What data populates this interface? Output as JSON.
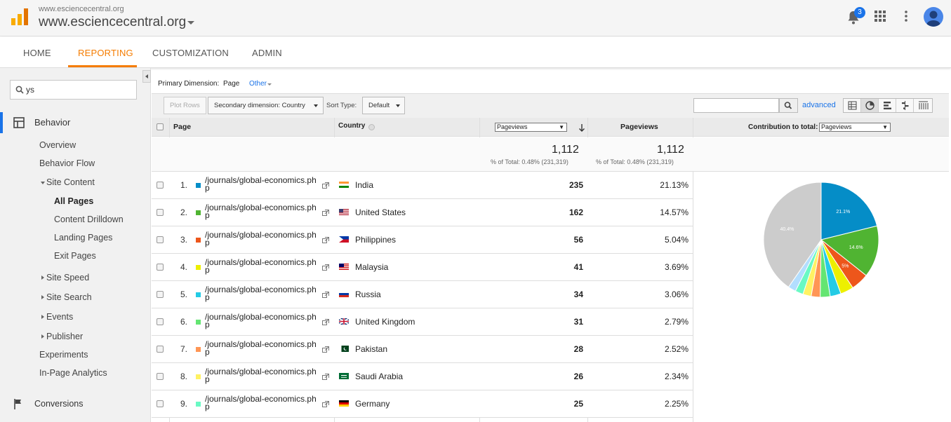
{
  "header": {
    "property_small": "www.esciencecentral.org",
    "property_main": "www.esciencecentral.org",
    "notification_count": "3"
  },
  "tabs": [
    {
      "label": "HOME"
    },
    {
      "label": "REPORTING"
    },
    {
      "label": "CUSTOMIZATION"
    },
    {
      "label": "ADMIN"
    }
  ],
  "sidebar": {
    "search_value": "ys",
    "behavior_label": "Behavior",
    "items": [
      {
        "label": "Overview"
      },
      {
        "label": "Behavior Flow"
      },
      {
        "label": "Site Content"
      },
      {
        "label": "All Pages"
      },
      {
        "label": "Content Drilldown"
      },
      {
        "label": "Landing Pages"
      },
      {
        "label": "Exit Pages"
      },
      {
        "label": "Site Speed"
      },
      {
        "label": "Site Search"
      },
      {
        "label": "Events"
      },
      {
        "label": "Publisher"
      },
      {
        "label": "Experiments"
      },
      {
        "label": "In-Page Analytics"
      }
    ],
    "conversions_label": "Conversions"
  },
  "primary_dimension": {
    "label": "Primary Dimension:",
    "current": "Page",
    "other": "Other"
  },
  "controls": {
    "plot_rows": "Plot Rows",
    "secondary_dimension": "Secondary dimension: Country",
    "sort_type_label": "Sort Type:",
    "sort_type_value": "Default",
    "advanced": "advanced"
  },
  "table": {
    "headers": {
      "page": "Page",
      "country": "Country",
      "metric_select": "Pageviews",
      "pageviews": "Pageviews",
      "contribution": "Contribution to total:",
      "contribution_select": "Pageviews"
    },
    "totals": {
      "metric1": "1,112",
      "metric1_sub": "% of Total: 0.48% (231,319)",
      "metric2": "1,112",
      "metric2_sub": "% of Total: 0.48% (231,319)"
    },
    "rows": [
      {
        "num": "1.",
        "page_line1": "/journals/global-economics.ph",
        "page_line2": "p",
        "country": "India",
        "pageviews": "235",
        "percent": "21.13%"
      },
      {
        "num": "2.",
        "page_line1": "/journals/global-economics.ph",
        "page_line2": "p",
        "country": "United States",
        "pageviews": "162",
        "percent": "14.57%"
      },
      {
        "num": "3.",
        "page_line1": "/journals/global-economics.ph",
        "page_line2": "p",
        "country": "Philippines",
        "pageviews": "56",
        "percent": "5.04%"
      },
      {
        "num": "4.",
        "page_line1": "/journals/global-economics.ph",
        "page_line2": "p",
        "country": "Malaysia",
        "pageviews": "41",
        "percent": "3.69%"
      },
      {
        "num": "5.",
        "page_line1": "/journals/global-economics.ph",
        "page_line2": "p",
        "country": "Russia",
        "pageviews": "34",
        "percent": "3.06%"
      },
      {
        "num": "6.",
        "page_line1": "/journals/global-economics.ph",
        "page_line2": "p",
        "country": "United Kingdom",
        "pageviews": "31",
        "percent": "2.79%"
      },
      {
        "num": "7.",
        "page_line1": "/journals/global-economics.ph",
        "page_line2": "p",
        "country": "Pakistan",
        "pageviews": "28",
        "percent": "2.52%"
      },
      {
        "num": "8.",
        "page_line1": "/journals/global-economics.ph",
        "page_line2": "p",
        "country": "Saudi Arabia",
        "pageviews": "26",
        "percent": "2.34%"
      },
      {
        "num": "9.",
        "page_line1": "/journals/global-economics.ph",
        "page_line2": "p",
        "country": "Germany",
        "pageviews": "25",
        "percent": "2.25%"
      }
    ],
    "swatch_colors": [
      "#058dc7",
      "#50b432",
      "#ed561b",
      "#edef00",
      "#24cbe5",
      "#64e572",
      "#ff9655",
      "#fff263",
      "#6af9c4"
    ]
  },
  "chart_data": {
    "type": "pie",
    "slices": [
      {
        "value": 21.13,
        "color": "#058dc7",
        "label": "21.1%"
      },
      {
        "value": 14.57,
        "color": "#50b432",
        "label": "14.6%"
      },
      {
        "value": 5.04,
        "color": "#ed561b",
        "label": "5%"
      },
      {
        "value": 3.69,
        "color": "#edef00",
        "label": ""
      },
      {
        "value": 3.06,
        "color": "#24cbe5",
        "label": ""
      },
      {
        "value": 2.79,
        "color": "#64e572",
        "label": ""
      },
      {
        "value": 2.52,
        "color": "#ff9655",
        "label": ""
      },
      {
        "value": 2.34,
        "color": "#fff263",
        "label": ""
      },
      {
        "value": 2.25,
        "color": "#6af9c4",
        "label": ""
      },
      {
        "value": 2.21,
        "color": "#b2deff",
        "label": ""
      },
      {
        "value": 40.4,
        "color": "#cccccc",
        "label": "40.4%"
      }
    ]
  },
  "colors": {
    "accent": "#f57c00",
    "link": "#1a73e8"
  }
}
